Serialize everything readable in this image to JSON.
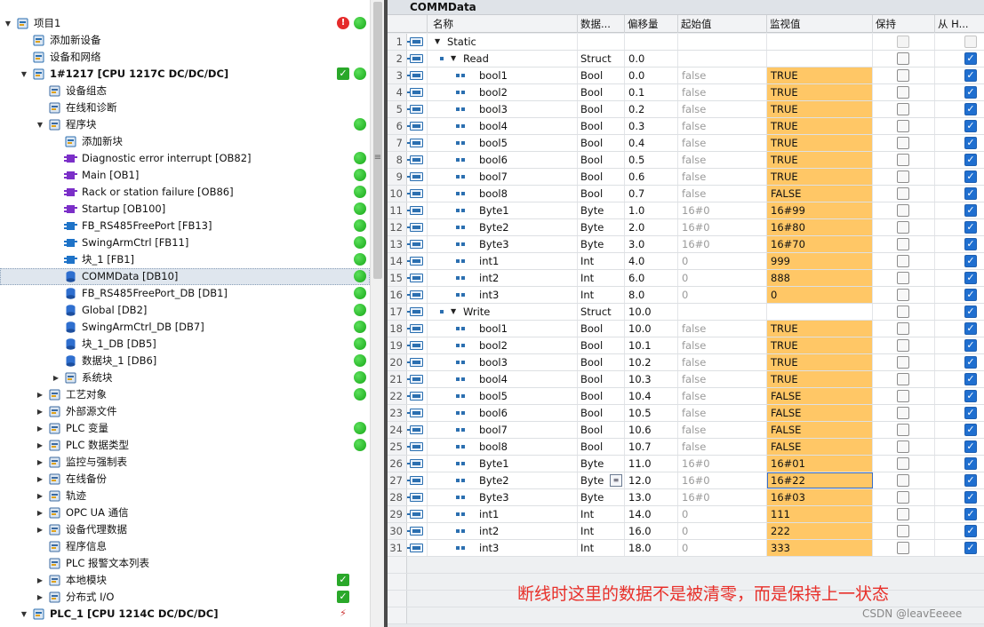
{
  "tree": {
    "items": [
      {
        "label": "项目1",
        "level": 0,
        "toggle": "open",
        "icon": "project-icon",
        "status": [
          "error",
          "ok"
        ]
      },
      {
        "label": "添加新设备",
        "level": 1,
        "toggle": "",
        "icon": "add-device-icon",
        "status": []
      },
      {
        "label": "设备和网络",
        "level": 1,
        "toggle": "",
        "icon": "network-icon",
        "status": []
      },
      {
        "label": "1#1217 [CPU 1217C DC/DC/DC]",
        "level": 1,
        "toggle": "open",
        "icon": "plc-icon",
        "status": [
          "check",
          "ok"
        ],
        "bold": true
      },
      {
        "label": "设备组态",
        "level": 2,
        "toggle": "",
        "icon": "device-config-icon",
        "status": []
      },
      {
        "label": "在线和诊断",
        "level": 2,
        "toggle": "",
        "icon": "diagnostics-icon",
        "status": []
      },
      {
        "label": "程序块",
        "level": 2,
        "toggle": "open",
        "icon": "program-blocks-icon",
        "status": [
          "ok"
        ]
      },
      {
        "label": "添加新块",
        "level": 3,
        "toggle": "",
        "icon": "add-block-icon",
        "status": []
      },
      {
        "label": "Diagnostic error interrupt [OB82]",
        "level": 3,
        "toggle": "",
        "icon": "ob-icon",
        "status": [
          "ok"
        ]
      },
      {
        "label": "Main [OB1]",
        "level": 3,
        "toggle": "",
        "icon": "ob-icon",
        "status": [
          "ok"
        ]
      },
      {
        "label": "Rack or station failure [OB86]",
        "level": 3,
        "toggle": "",
        "icon": "ob-icon",
        "status": [
          "ok"
        ]
      },
      {
        "label": "Startup [OB100]",
        "level": 3,
        "toggle": "",
        "icon": "ob-icon",
        "status": [
          "ok"
        ]
      },
      {
        "label": "FB_RS485FreePort [FB13]",
        "level": 3,
        "toggle": "",
        "icon": "fb-icon",
        "status": [
          "ok"
        ]
      },
      {
        "label": "SwingArmCtrl [FB11]",
        "level": 3,
        "toggle": "",
        "icon": "fb-icon",
        "status": [
          "ok"
        ]
      },
      {
        "label": "块_1 [FB1]",
        "level": 3,
        "toggle": "",
        "icon": "fb-icon",
        "status": [
          "ok"
        ]
      },
      {
        "label": "COMMData [DB10]",
        "level": 3,
        "toggle": "",
        "icon": "db-icon",
        "status": [
          "ok"
        ],
        "selected": true
      },
      {
        "label": "FB_RS485FreePort_DB [DB1]",
        "level": 3,
        "toggle": "",
        "icon": "db-icon",
        "status": [
          "ok"
        ]
      },
      {
        "label": "Global [DB2]",
        "level": 3,
        "toggle": "",
        "icon": "db-icon",
        "status": [
          "ok"
        ]
      },
      {
        "label": "SwingArmCtrl_DB [DB7]",
        "level": 3,
        "toggle": "",
        "icon": "db-icon",
        "status": [
          "ok"
        ]
      },
      {
        "label": "块_1_DB [DB5]",
        "level": 3,
        "toggle": "",
        "icon": "db-icon",
        "status": [
          "ok"
        ]
      },
      {
        "label": "数据块_1 [DB6]",
        "level": 3,
        "toggle": "",
        "icon": "db-icon",
        "status": [
          "ok"
        ]
      },
      {
        "label": "系统块",
        "level": 3,
        "toggle": "closed",
        "icon": "system-blocks-icon",
        "status": [
          "ok"
        ]
      },
      {
        "label": "工艺对象",
        "level": 2,
        "toggle": "closed",
        "icon": "technology-objects-icon",
        "status": [
          "ok"
        ]
      },
      {
        "label": "外部源文件",
        "level": 2,
        "toggle": "closed",
        "icon": "external-source-icon",
        "status": []
      },
      {
        "label": "PLC 变量",
        "level": 2,
        "toggle": "closed",
        "icon": "plc-tags-icon",
        "status": [
          "ok"
        ]
      },
      {
        "label": "PLC 数据类型",
        "level": 2,
        "toggle": "closed",
        "icon": "plc-datatypes-icon",
        "status": [
          "ok"
        ]
      },
      {
        "label": "监控与强制表",
        "level": 2,
        "toggle": "closed",
        "icon": "watch-table-icon",
        "status": []
      },
      {
        "label": "在线备份",
        "level": 2,
        "toggle": "closed",
        "icon": "online-backup-icon",
        "status": []
      },
      {
        "label": "轨迹",
        "level": 2,
        "toggle": "closed",
        "icon": "traces-icon",
        "status": []
      },
      {
        "label": "OPC UA 通信",
        "level": 2,
        "toggle": "closed",
        "icon": "opcua-icon",
        "status": []
      },
      {
        "label": "设备代理数据",
        "level": 2,
        "toggle": "closed",
        "icon": "proxy-data-icon",
        "status": []
      },
      {
        "label": "程序信息",
        "level": 2,
        "toggle": "",
        "icon": "program-info-icon",
        "status": []
      },
      {
        "label": "PLC 报警文本列表",
        "level": 2,
        "toggle": "",
        "icon": "alarm-text-icon",
        "status": []
      },
      {
        "label": "本地模块",
        "level": 2,
        "toggle": "closed",
        "icon": "local-modules-icon",
        "status": [
          "check"
        ]
      },
      {
        "label": "分布式 I/O",
        "level": 2,
        "toggle": "closed",
        "icon": "distributed-io-icon",
        "status": [
          "check"
        ]
      },
      {
        "label": "PLC_1 [CPU 1214C DC/DC/DC]",
        "level": 1,
        "toggle": "open",
        "icon": "plc-icon",
        "status": [
          "network"
        ],
        "bold": true
      }
    ]
  },
  "editor": {
    "title": "COMMData",
    "columns": [
      "名称",
      "数据...",
      "偏移量",
      "起始值",
      "监视值",
      "保持",
      "从 H..."
    ],
    "rows": [
      {
        "n": "1",
        "level": 0,
        "toggle": "open",
        "name": "Static",
        "dt": "",
        "off": "",
        "sv": "",
        "mv": "",
        "hl": false,
        "ret": "dim",
        "from": "dim",
        "bullet": false
      },
      {
        "n": "2",
        "level": 1,
        "toggle": "open",
        "name": "Read",
        "dt": "Struct",
        "off": "0.0",
        "sv": "",
        "mv": "",
        "hl": false,
        "ret": "off",
        "from": "on",
        "bullet": true
      },
      {
        "n": "3",
        "level": 2,
        "toggle": "",
        "name": "bool1",
        "dt": "Bool",
        "off": "0.0",
        "sv": "false",
        "mv": "TRUE",
        "hl": true,
        "ret": "off",
        "from": "on",
        "bullet": true
      },
      {
        "n": "4",
        "level": 2,
        "toggle": "",
        "name": "bool2",
        "dt": "Bool",
        "off": "0.1",
        "sv": "false",
        "mv": "TRUE",
        "hl": true,
        "ret": "off",
        "from": "on",
        "bullet": true
      },
      {
        "n": "5",
        "level": 2,
        "toggle": "",
        "name": "bool3",
        "dt": "Bool",
        "off": "0.2",
        "sv": "false",
        "mv": "TRUE",
        "hl": true,
        "ret": "off",
        "from": "on",
        "bullet": true
      },
      {
        "n": "6",
        "level": 2,
        "toggle": "",
        "name": "bool4",
        "dt": "Bool",
        "off": "0.3",
        "sv": "false",
        "mv": "TRUE",
        "hl": true,
        "ret": "off",
        "from": "on",
        "bullet": true
      },
      {
        "n": "7",
        "level": 2,
        "toggle": "",
        "name": "bool5",
        "dt": "Bool",
        "off": "0.4",
        "sv": "false",
        "mv": "TRUE",
        "hl": true,
        "ret": "off",
        "from": "on",
        "bullet": true
      },
      {
        "n": "8",
        "level": 2,
        "toggle": "",
        "name": "bool6",
        "dt": "Bool",
        "off": "0.5",
        "sv": "false",
        "mv": "TRUE",
        "hl": true,
        "ret": "off",
        "from": "on",
        "bullet": true
      },
      {
        "n": "9",
        "level": 2,
        "toggle": "",
        "name": "bool7",
        "dt": "Bool",
        "off": "0.6",
        "sv": "false",
        "mv": "TRUE",
        "hl": true,
        "ret": "off",
        "from": "on",
        "bullet": true
      },
      {
        "n": "10",
        "level": 2,
        "toggle": "",
        "name": "bool8",
        "dt": "Bool",
        "off": "0.7",
        "sv": "false",
        "mv": "FALSE",
        "hl": true,
        "ret": "off",
        "from": "on",
        "bullet": true
      },
      {
        "n": "11",
        "level": 2,
        "toggle": "",
        "name": "Byte1",
        "dt": "Byte",
        "off": "1.0",
        "sv": "16#0",
        "mv": "16#99",
        "hl": true,
        "ret": "off",
        "from": "on",
        "bullet": true
      },
      {
        "n": "12",
        "level": 2,
        "toggle": "",
        "name": "Byte2",
        "dt": "Byte",
        "off": "2.0",
        "sv": "16#0",
        "mv": "16#80",
        "hl": true,
        "ret": "off",
        "from": "on",
        "bullet": true
      },
      {
        "n": "13",
        "level": 2,
        "toggle": "",
        "name": "Byte3",
        "dt": "Byte",
        "off": "3.0",
        "sv": "16#0",
        "mv": "16#70",
        "hl": true,
        "ret": "off",
        "from": "on",
        "bullet": true
      },
      {
        "n": "14",
        "level": 2,
        "toggle": "",
        "name": "int1",
        "dt": "Int",
        "off": "4.0",
        "sv": "0",
        "mv": "999",
        "hl": true,
        "ret": "off",
        "from": "on",
        "bullet": true
      },
      {
        "n": "15",
        "level": 2,
        "toggle": "",
        "name": "int2",
        "dt": "Int",
        "off": "6.0",
        "sv": "0",
        "mv": "888",
        "hl": true,
        "ret": "off",
        "from": "on",
        "bullet": true
      },
      {
        "n": "16",
        "level": 2,
        "toggle": "",
        "name": "int3",
        "dt": "Int",
        "off": "8.0",
        "sv": "0",
        "mv": "0",
        "hl": true,
        "ret": "off",
        "from": "on",
        "bullet": true
      },
      {
        "n": "17",
        "level": 1,
        "toggle": "open",
        "name": "Write",
        "dt": "Struct",
        "off": "10.0",
        "sv": "",
        "mv": "",
        "hl": false,
        "ret": "off",
        "from": "on",
        "bullet": true
      },
      {
        "n": "18",
        "level": 2,
        "toggle": "",
        "name": "bool1",
        "dt": "Bool",
        "off": "10.0",
        "sv": "false",
        "mv": "TRUE",
        "hl": true,
        "ret": "off",
        "from": "on",
        "bullet": true
      },
      {
        "n": "19",
        "level": 2,
        "toggle": "",
        "name": "bool2",
        "dt": "Bool",
        "off": "10.1",
        "sv": "false",
        "mv": "TRUE",
        "hl": true,
        "ret": "off",
        "from": "on",
        "bullet": true
      },
      {
        "n": "20",
        "level": 2,
        "toggle": "",
        "name": "bool3",
        "dt": "Bool",
        "off": "10.2",
        "sv": "false",
        "mv": "TRUE",
        "hl": true,
        "ret": "off",
        "from": "on",
        "bullet": true
      },
      {
        "n": "21",
        "level": 2,
        "toggle": "",
        "name": "bool4",
        "dt": "Bool",
        "off": "10.3",
        "sv": "false",
        "mv": "TRUE",
        "hl": true,
        "ret": "off",
        "from": "on",
        "bullet": true
      },
      {
        "n": "22",
        "level": 2,
        "toggle": "",
        "name": "bool5",
        "dt": "Bool",
        "off": "10.4",
        "sv": "false",
        "mv": "FALSE",
        "hl": true,
        "ret": "off",
        "from": "on",
        "bullet": true
      },
      {
        "n": "23",
        "level": 2,
        "toggle": "",
        "name": "bool6",
        "dt": "Bool",
        "off": "10.5",
        "sv": "false",
        "mv": "FALSE",
        "hl": true,
        "ret": "off",
        "from": "on",
        "bullet": true
      },
      {
        "n": "24",
        "level": 2,
        "toggle": "",
        "name": "bool7",
        "dt": "Bool",
        "off": "10.6",
        "sv": "false",
        "mv": "FALSE",
        "hl": true,
        "ret": "off",
        "from": "on",
        "bullet": true
      },
      {
        "n": "25",
        "level": 2,
        "toggle": "",
        "name": "bool8",
        "dt": "Bool",
        "off": "10.7",
        "sv": "false",
        "mv": "FALSE",
        "hl": true,
        "ret": "off",
        "from": "on",
        "bullet": true
      },
      {
        "n": "26",
        "level": 2,
        "toggle": "",
        "name": "Byte1",
        "dt": "Byte",
        "off": "11.0",
        "sv": "16#0",
        "mv": "16#01",
        "hl": true,
        "ret": "off",
        "from": "on",
        "bullet": true
      },
      {
        "n": "27",
        "level": 2,
        "toggle": "",
        "name": "Byte2",
        "dt": "Byte",
        "off": "12.0",
        "sv": "16#0",
        "mv": "16#22",
        "hl": true,
        "ret": "off",
        "from": "on",
        "bullet": true,
        "selected": true
      },
      {
        "n": "28",
        "level": 2,
        "toggle": "",
        "name": "Byte3",
        "dt": "Byte",
        "off": "13.0",
        "sv": "16#0",
        "mv": "16#03",
        "hl": true,
        "ret": "off",
        "from": "on",
        "bullet": true
      },
      {
        "n": "29",
        "level": 2,
        "toggle": "",
        "name": "int1",
        "dt": "Int",
        "off": "14.0",
        "sv": "0",
        "mv": "111",
        "hl": true,
        "ret": "off",
        "from": "on",
        "bullet": true
      },
      {
        "n": "30",
        "level": 2,
        "toggle": "",
        "name": "int2",
        "dt": "Int",
        "off": "16.0",
        "sv": "0",
        "mv": "222",
        "hl": true,
        "ret": "off",
        "from": "on",
        "bullet": true
      },
      {
        "n": "31",
        "level": 2,
        "toggle": "",
        "name": "int3",
        "dt": "Int",
        "off": "18.0",
        "sv": "0",
        "mv": "333",
        "hl": true,
        "ret": "off",
        "from": "on",
        "bullet": true
      }
    ]
  },
  "annotation": "断线时这里的数据不是被清零，而是保持上一状态",
  "watermark": "CSDN @leavEeeee",
  "colors": {
    "monitor_highlight": "#ffc766",
    "annotation": "#e8302a",
    "status_ok": "#17a717",
    "checkbox_on": "#1f6fd0"
  }
}
